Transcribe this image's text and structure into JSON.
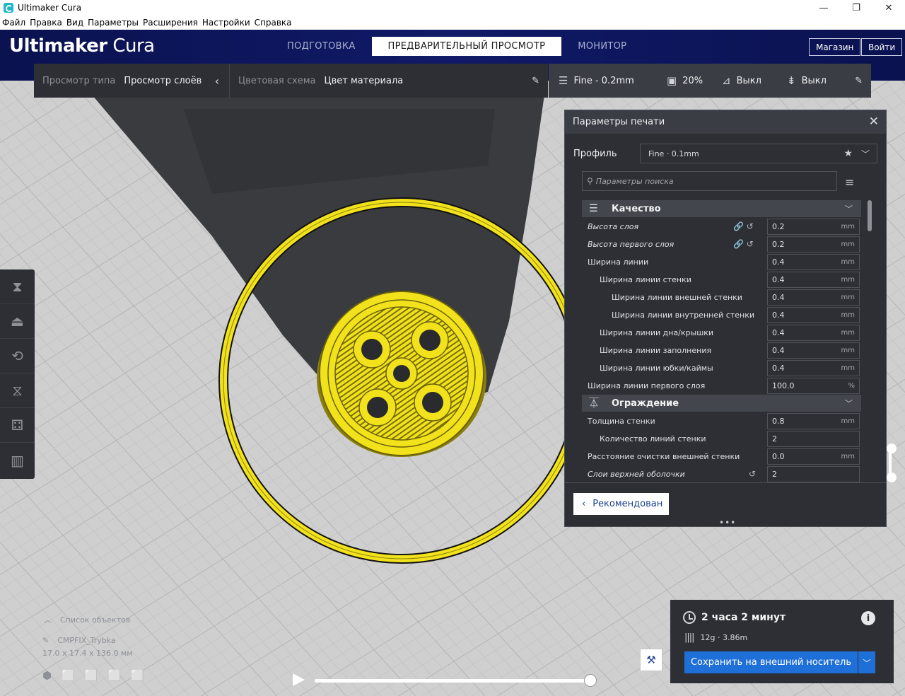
{
  "window": {
    "title": "Ultimaker Cura",
    "minimize": "—",
    "maximize": "❐",
    "close": "✕"
  },
  "menu": [
    "Файл",
    "Правка",
    "Вид",
    "Параметры",
    "Расширения",
    "Настройки",
    "Справка"
  ],
  "header": {
    "brand_bold": "Ultimaker",
    "brand_light": " Cura",
    "tabs": [
      "ПОДГОТОВКА",
      "ПРЕДВАРИТЕЛЬНЫЙ ПРОСМОТР",
      "МОНИТОР"
    ],
    "active_tab": "ПРЕДВАРИТЕЛЬНЫЙ ПРОСМОТР",
    "store_button": "Магазин",
    "login_button": "Войти"
  },
  "viewbar": {
    "view_type_label": "Просмотр типа",
    "view_type_value": "Просмотр слоёв",
    "color_scheme_label": "Цветовая схема",
    "color_scheme_value": "Цвет материала"
  },
  "printbar": {
    "profile": "Fine - 0.2mm",
    "infill": "20%",
    "support": "Выкл",
    "adhesion": "Выкл"
  },
  "settings_panel": {
    "title": "Параметры печати",
    "profile_label": "Профиль",
    "profile_value": "Fine · 0.1mm",
    "search_placeholder": "Параметры поиска",
    "categories": [
      {
        "name": "Качество",
        "rows": [
          {
            "label": "Высота слоя",
            "value": "0.2",
            "unit": "mm",
            "italic": true,
            "indent": 0,
            "icons": "link-reset"
          },
          {
            "label": "Высота первого слоя",
            "value": "0.2",
            "unit": "mm",
            "italic": true,
            "indent": 0,
            "icons": "link-reset"
          },
          {
            "label": "Ширина линии",
            "value": "0.4",
            "unit": "mm",
            "italic": false,
            "indent": 0,
            "icons": ""
          },
          {
            "label": "Ширина линии стенки",
            "value": "0.4",
            "unit": "mm",
            "italic": false,
            "indent": 1,
            "icons": ""
          },
          {
            "label": "Ширина линии внешней стенки",
            "value": "0.4",
            "unit": "mm",
            "italic": false,
            "indent": 2,
            "icons": ""
          },
          {
            "label": "Ширина линии внутренней стенки",
            "value": "0.4",
            "unit": "mm",
            "italic": false,
            "indent": 2,
            "icons": ""
          },
          {
            "label": "Ширина линии дна/крышки",
            "value": "0.4",
            "unit": "mm",
            "italic": false,
            "indent": 1,
            "icons": ""
          },
          {
            "label": "Ширина линии заполнения",
            "value": "0.4",
            "unit": "mm",
            "italic": false,
            "indent": 1,
            "icons": ""
          },
          {
            "label": "Ширина линии юбки/каймы",
            "value": "0.4",
            "unit": "mm",
            "italic": false,
            "indent": 1,
            "icons": ""
          },
          {
            "label": "Ширина линии первого слоя",
            "value": "100.0",
            "unit": "%",
            "italic": false,
            "indent": 0,
            "icons": ""
          }
        ]
      },
      {
        "name": "Ограждение",
        "rows": [
          {
            "label": "Толщина стенки",
            "value": "0.8",
            "unit": "mm",
            "italic": false,
            "indent": 0,
            "icons": ""
          },
          {
            "label": "Количество линий стенки",
            "value": "2",
            "unit": "",
            "italic": false,
            "indent": 1,
            "icons": ""
          },
          {
            "label": "Расстояние очистки внешней стенки",
            "value": "0.0",
            "unit": "mm",
            "italic": false,
            "indent": 0,
            "icons": ""
          },
          {
            "label": "Слои верхней оболочки",
            "value": "2",
            "unit": "",
            "italic": true,
            "indent": 0,
            "icons": "reset"
          }
        ]
      }
    ],
    "recommended_button": "Рекомендован"
  },
  "objects": {
    "list_label": "Список объектов",
    "object_name": "CMPFIX_Trybka",
    "dimensions": "17.0 x 17.4 x 136.0 мм"
  },
  "output": {
    "time": "2 часа 2 минут",
    "material": "12g · 3.86m",
    "save_button": "Сохранить на внешний носитель"
  },
  "colors": {
    "accent": "#1f6fd8",
    "header": "#0b1357",
    "panel": "#2d2f34",
    "model": "#f2e21c"
  }
}
